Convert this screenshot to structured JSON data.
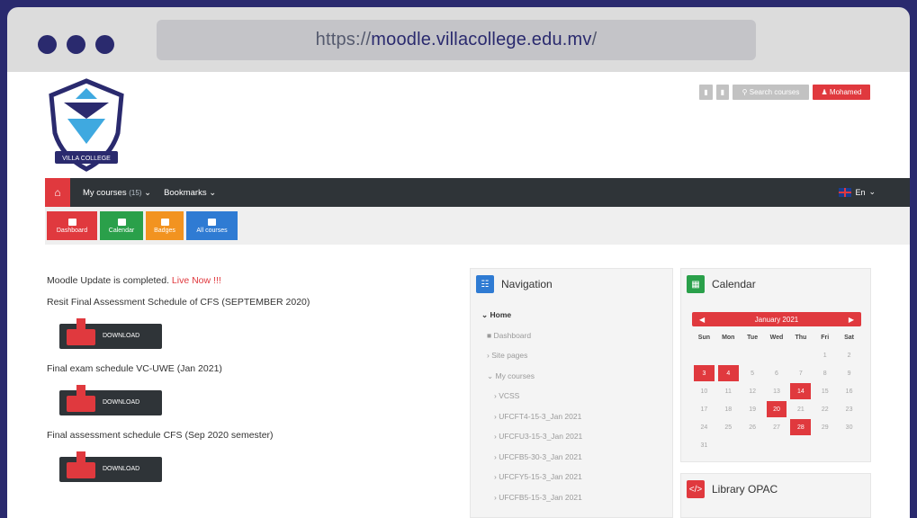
{
  "browser": {
    "url_prefix": "https://",
    "url_host": "moodle.villacollege.edu.mv",
    "url_suffix": "/"
  },
  "header": {
    "logo_text": "VILLA COLLEGE",
    "search_label": "Search courses",
    "user_label": "Mohamed",
    "lang_label": "En"
  },
  "navbar": {
    "my_courses": "My courses",
    "my_courses_tag": "(15)",
    "bookmarks": "Bookmarks"
  },
  "quicklinks": [
    {
      "label": "Dashboard",
      "color": "#e0393e"
    },
    {
      "label": "Calendar",
      "color": "#2aa04a"
    },
    {
      "label": "Badges",
      "color": "#f29320"
    },
    {
      "label": "All courses",
      "color": "#2f7bd3"
    }
  ],
  "main": {
    "update_text": "Moodle Update is completed.",
    "live_text": "Live Now !!!",
    "resit_title": "Resit Final Assessment Schedule of CFS (SEPTEMBER 2020)",
    "exam_title": "Final exam schedule VC-UWE (Jan 2021)",
    "assessment_title": "Final assessment schedule CFS (Sep 2020 semester)",
    "download_label": "DOWNLOAD"
  },
  "navigation": {
    "title": "Navigation",
    "items": [
      "Home",
      "Dashboard",
      "Site pages",
      "My courses",
      "VCSS",
      "UFCFT4-15-3_Jan 2021",
      "UFCFU3-15-3_Jan 2021",
      "UFCFB5-30-3_Jan 2021",
      "UFCFY5-15-3_Jan 2021",
      "UFCFB5-15-3_Jan 2021"
    ]
  },
  "calendar": {
    "title": "Calendar",
    "month": "January 2021",
    "weekdays": [
      "Sun",
      "Mon",
      "Tue",
      "Wed",
      "Thu",
      "Fri",
      "Sat"
    ],
    "weeks": [
      [
        "",
        "",
        "",
        "",
        "",
        "1",
        "2"
      ],
      [
        "3",
        "4",
        "5",
        "6",
        "7",
        "8",
        "9"
      ],
      [
        "10",
        "11",
        "12",
        "13",
        "14",
        "15",
        "16"
      ],
      [
        "17",
        "18",
        "19",
        "20",
        "21",
        "22",
        "23"
      ],
      [
        "24",
        "25",
        "26",
        "27",
        "28",
        "29",
        "30"
      ],
      [
        "31",
        "",
        "",
        "",
        "",
        "",
        ""
      ]
    ],
    "highlighted": [
      "3",
      "4",
      "14",
      "20",
      "28"
    ]
  },
  "library": {
    "title": "Library OPAC"
  }
}
